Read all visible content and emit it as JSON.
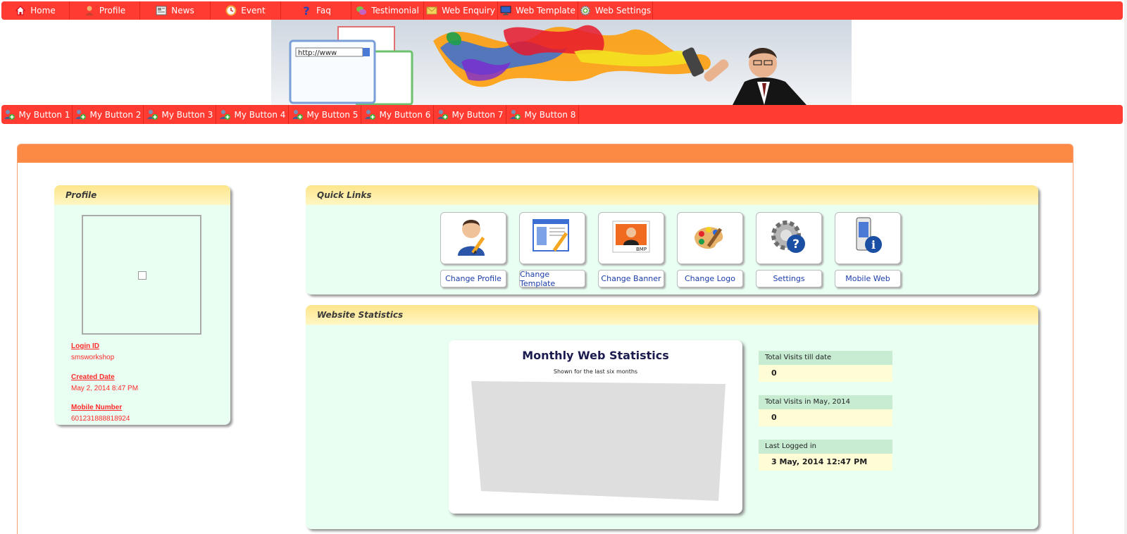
{
  "top_nav": [
    {
      "label": "Home",
      "icon": "home-icon",
      "color": "#d9342b"
    },
    {
      "label": "Profile",
      "icon": "user-icon",
      "color": "#d08a3a"
    },
    {
      "label": "News",
      "icon": "newspaper-icon",
      "color": "#9aa0a8"
    },
    {
      "label": "Event",
      "icon": "clock-icon",
      "color": "#f2a23a"
    },
    {
      "label": "Faq",
      "icon": "question-icon",
      "color": "#2643b7"
    },
    {
      "label": "Testimonial",
      "icon": "chat-bubbles-icon",
      "color": "#7bc24a"
    },
    {
      "label": "Web Enquiry",
      "icon": "envelope-icon",
      "color": "#f4d35e"
    },
    {
      "label": "Web Template",
      "icon": "monitor-icon",
      "color": "#2f62c4"
    },
    {
      "label": "Web Settings",
      "icon": "gear-plus-icon",
      "color": "#6bb34a"
    }
  ],
  "sub_nav": [
    {
      "label": "My Button 1"
    },
    {
      "label": "My Button 2"
    },
    {
      "label": "My Button 3"
    },
    {
      "label": "My Button 4"
    },
    {
      "label": "My Button 5"
    },
    {
      "label": "My Button 6"
    },
    {
      "label": "My Button 7"
    },
    {
      "label": "My Button 8"
    }
  ],
  "banner": {
    "url_text": "http://www"
  },
  "profile": {
    "title": "Profile",
    "login_id_label": "Login ID",
    "login_id": "smsworkshop",
    "created_label": "Created Date",
    "created": "May 2, 2014 8:47 PM",
    "mobile_label": "Mobile Number",
    "mobile": "601231888818924"
  },
  "quick_links": {
    "title": "Quick Links",
    "items": [
      {
        "label": "Change Profile",
        "icon": "user-edit-icon"
      },
      {
        "label": "Change Template",
        "icon": "template-edit-icon"
      },
      {
        "label": "Change Banner",
        "icon": "banner-image-icon"
      },
      {
        "label": "Change Logo",
        "icon": "palette-icon"
      },
      {
        "label": "Settings",
        "icon": "gear-help-icon"
      },
      {
        "label": "Mobile Web",
        "icon": "mobile-info-icon"
      }
    ]
  },
  "stats": {
    "title": "Website Statistics",
    "chart_title": "Monthly Web Statistics",
    "chart_subtitle": "Shown for the last six months",
    "total_label": "Total Visits till date",
    "total_value": "0",
    "month_label": "Total Visits in May, 2014",
    "month_value": "0",
    "last_label": "Last Logged in",
    "last_value": "3 May, 2014 12:47 PM"
  }
}
